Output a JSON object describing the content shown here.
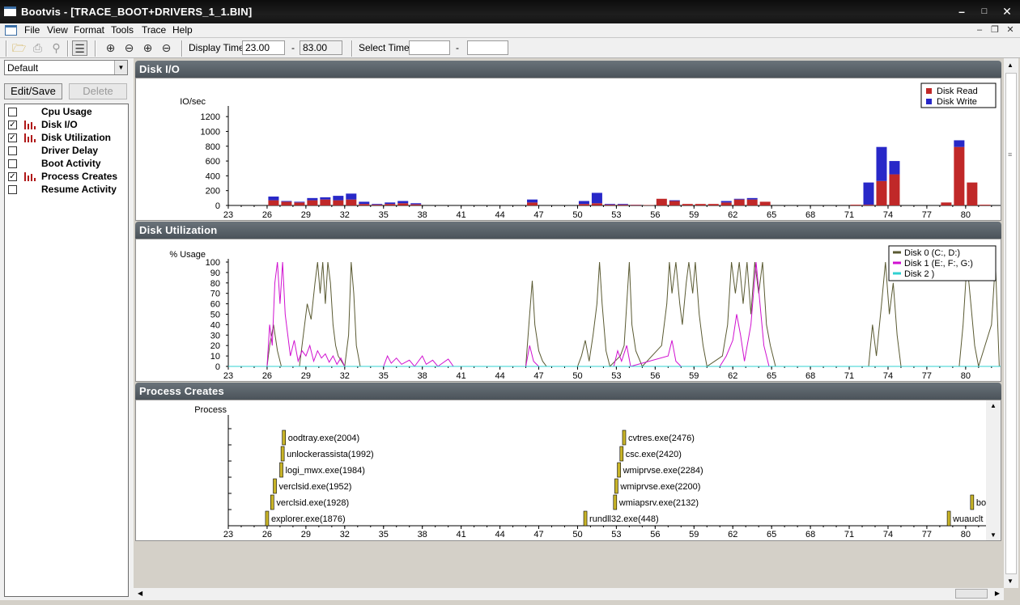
{
  "window": {
    "title": "Bootvis - [TRACE_BOOT+DRIVERS_1_1.BIN]"
  },
  "menu": [
    "File",
    "View",
    "Format",
    "Tools",
    "Trace",
    "Help"
  ],
  "toolbar": {
    "display_time_label": "Display Time",
    "display_start": "23.00",
    "display_dash": "-",
    "display_end": "83.00",
    "select_time_label": "Select Time",
    "select_start": "",
    "select_dash": "-",
    "select_end": ""
  },
  "sidebar": {
    "preset": "Default",
    "edit_save_label": "Edit/Save",
    "delete_label": "Delete",
    "items": [
      {
        "label": "Cpu Usage",
        "checked": false
      },
      {
        "label": "Disk I/O",
        "checked": true
      },
      {
        "label": "Disk Utilization",
        "checked": true
      },
      {
        "label": "Driver Delay",
        "checked": false
      },
      {
        "label": "Boot Activity",
        "checked": false
      },
      {
        "label": "Process Creates",
        "checked": true
      },
      {
        "label": "Resume Activity",
        "checked": false
      }
    ]
  },
  "colors": {
    "read": "#c02828",
    "write": "#2828c8",
    "disk0": "#5a5a32",
    "disk1": "#d010d0",
    "disk2": "#30d0d0",
    "process": "#c8b428"
  },
  "x_ticks": [
    "23",
    "26",
    "29",
    "32",
    "35",
    "38",
    "41",
    "44",
    "47",
    "50",
    "53",
    "56",
    "59",
    "62",
    "65",
    "68",
    "71",
    "74",
    "77",
    "80"
  ],
  "chart_data": [
    {
      "type": "bar",
      "title": "Disk I/O",
      "ylabel": "IO/sec",
      "ylim": [
        0,
        1300
      ],
      "yticks": [
        "0",
        "200",
        "400",
        "600",
        "800",
        "1000",
        "1200"
      ],
      "xlim": [
        23,
        83
      ],
      "legend_position": "top-right",
      "series": [
        {
          "name": "Disk Read",
          "color": "#c02828",
          "points": [
            [
              26.5,
              70
            ],
            [
              27.5,
              50
            ],
            [
              28.5,
              40
            ],
            [
              29.5,
              70
            ],
            [
              30.5,
              80
            ],
            [
              31.5,
              70
            ],
            [
              32.5,
              80
            ],
            [
              33.5,
              20
            ],
            [
              34.5,
              10
            ],
            [
              35.5,
              20
            ],
            [
              36.5,
              30
            ],
            [
              37.5,
              15
            ],
            [
              46.5,
              40
            ],
            [
              50.5,
              20
            ],
            [
              51.5,
              30
            ],
            [
              52.5,
              10
            ],
            [
              53.5,
              10
            ],
            [
              54.5,
              8
            ],
            [
              55.5,
              5
            ],
            [
              56.5,
              90
            ],
            [
              57.5,
              60
            ],
            [
              58.5,
              20
            ],
            [
              59.5,
              20
            ],
            [
              60.5,
              20
            ],
            [
              61.5,
              40
            ],
            [
              62.5,
              80
            ],
            [
              63.5,
              80
            ],
            [
              64.5,
              50
            ],
            [
              71.5,
              10
            ],
            [
              72.5,
              10
            ],
            [
              73.5,
              330
            ],
            [
              74.5,
              420
            ],
            [
              78.5,
              40
            ],
            [
              79.5,
              790
            ],
            [
              80.5,
              310
            ],
            [
              81.5,
              10
            ]
          ]
        },
        {
          "name": "Disk Write",
          "color": "#2828c8",
          "points": [
            [
              26.5,
              50
            ],
            [
              27.5,
              10
            ],
            [
              28.5,
              10
            ],
            [
              29.5,
              30
            ],
            [
              30.5,
              30
            ],
            [
              31.5,
              60
            ],
            [
              32.5,
              80
            ],
            [
              33.5,
              30
            ],
            [
              34.5,
              10
            ],
            [
              35.5,
              20
            ],
            [
              36.5,
              30
            ],
            [
              37.5,
              15
            ],
            [
              46.5,
              40
            ],
            [
              50.5,
              40
            ],
            [
              51.5,
              140
            ],
            [
              52.5,
              10
            ],
            [
              53.5,
              10
            ],
            [
              54.5,
              2
            ],
            [
              55.5,
              0
            ],
            [
              56.5,
              0
            ],
            [
              57.5,
              10
            ],
            [
              58.5,
              0
            ],
            [
              59.5,
              0
            ],
            [
              60.5,
              0
            ],
            [
              61.5,
              20
            ],
            [
              62.5,
              10
            ],
            [
              63.5,
              20
            ],
            [
              64.5,
              0
            ],
            [
              71.5,
              0
            ],
            [
              72.5,
              300
            ],
            [
              73.5,
              460
            ],
            [
              74.5,
              180
            ],
            [
              78.5,
              0
            ],
            [
              79.5,
              90
            ],
            [
              80.5,
              0
            ],
            [
              81.5,
              0
            ]
          ]
        }
      ]
    },
    {
      "type": "line",
      "title": "Disk Utilization",
      "ylabel": "% Usage",
      "ylim": [
        0,
        100
      ],
      "yticks": [
        "0",
        "10",
        "20",
        "30",
        "40",
        "50",
        "60",
        "70",
        "80",
        "90",
        "100"
      ],
      "xlim": [
        23,
        83
      ],
      "legend_position": "top-right",
      "series": [
        {
          "name": "Disk 0 (C:, D:)",
          "color": "#5a5a32",
          "points": [
            [
              23,
              0
            ],
            [
              26,
              0
            ],
            [
              26.2,
              20
            ],
            [
              26.5,
              40
            ],
            [
              26.8,
              15
            ],
            [
              27.1,
              0
            ],
            [
              28.5,
              0
            ],
            [
              28.8,
              30
            ],
            [
              29.1,
              60
            ],
            [
              29.4,
              45
            ],
            [
              29.7,
              80
            ],
            [
              29.9,
              100
            ],
            [
              30.1,
              70
            ],
            [
              30.3,
              100
            ],
            [
              30.5,
              60
            ],
            [
              30.7,
              100
            ],
            [
              30.9,
              80
            ],
            [
              31.1,
              40
            ],
            [
              31.3,
              20
            ],
            [
              31.5,
              10
            ],
            [
              32,
              0
            ],
            [
              32.3,
              30
            ],
            [
              32.5,
              100
            ],
            [
              32.7,
              70
            ],
            [
              32.9,
              20
            ],
            [
              33.2,
              0
            ],
            [
              46,
              0
            ],
            [
              46.3,
              50
            ],
            [
              46.5,
              82
            ],
            [
              46.7,
              40
            ],
            [
              47,
              15
            ],
            [
              47.3,
              5
            ],
            [
              47.6,
              0
            ],
            [
              50,
              0
            ],
            [
              50.3,
              10
            ],
            [
              50.6,
              25
            ],
            [
              50.9,
              5
            ],
            [
              51.2,
              30
            ],
            [
              51.5,
              60
            ],
            [
              51.7,
              100
            ],
            [
              51.9,
              60
            ],
            [
              52.2,
              15
            ],
            [
              52.5,
              0
            ],
            [
              53.3,
              10
            ],
            [
              53.6,
              20
            ],
            [
              54,
              100
            ],
            [
              54.2,
              40
            ],
            [
              54.5,
              15
            ],
            [
              55,
              0
            ],
            [
              56.5,
              20
            ],
            [
              56.9,
              60
            ],
            [
              57.1,
              100
            ],
            [
              57.3,
              70
            ],
            [
              57.6,
              100
            ],
            [
              57.9,
              60
            ],
            [
              58.1,
              40
            ],
            [
              58.4,
              80
            ],
            [
              58.6,
              100
            ],
            [
              58.9,
              70
            ],
            [
              59.1,
              100
            ],
            [
              59.4,
              50
            ],
            [
              59.7,
              20
            ],
            [
              60,
              0
            ],
            [
              61.2,
              10
            ],
            [
              61.6,
              40
            ],
            [
              61.9,
              100
            ],
            [
              62.2,
              70
            ],
            [
              62.5,
              100
            ],
            [
              62.8,
              60
            ],
            [
              63.1,
              100
            ],
            [
              63.4,
              50
            ],
            [
              63.7,
              100
            ],
            [
              64,
              70
            ],
            [
              64.3,
              100
            ],
            [
              64.6,
              40
            ],
            [
              64.9,
              20
            ],
            [
              65.3,
              0
            ],
            [
              72.5,
              0
            ],
            [
              72.8,
              40
            ],
            [
              73.1,
              10
            ],
            [
              73.5,
              60
            ],
            [
              73.8,
              100
            ],
            [
              74.1,
              50
            ],
            [
              74.4,
              80
            ],
            [
              74.7,
              30
            ],
            [
              75,
              0
            ],
            [
              79.5,
              0
            ],
            [
              79.8,
              40
            ],
            [
              80.1,
              100
            ],
            [
              80.4,
              60
            ],
            [
              80.7,
              20
            ],
            [
              81,
              0
            ],
            [
              82,
              40
            ],
            [
              82.3,
              100
            ],
            [
              82.6,
              0
            ],
            [
              83,
              0
            ]
          ]
        },
        {
          "name": "Disk 1 (E:, F:, G:)",
          "color": "#d010d0",
          "points": [
            [
              23,
              0
            ],
            [
              26,
              0
            ],
            [
              26.2,
              40
            ],
            [
              26.4,
              20
            ],
            [
              26.6,
              80
            ],
            [
              26.8,
              100
            ],
            [
              27,
              60
            ],
            [
              27.2,
              100
            ],
            [
              27.4,
              50
            ],
            [
              27.6,
              30
            ],
            [
              27.8,
              10
            ],
            [
              28.1,
              25
            ],
            [
              28.4,
              5
            ],
            [
              28.7,
              15
            ],
            [
              29,
              10
            ],
            [
              29.3,
              20
            ],
            [
              29.6,
              5
            ],
            [
              29.9,
              15
            ],
            [
              30.2,
              8
            ],
            [
              30.5,
              12
            ],
            [
              30.8,
              4
            ],
            [
              31.1,
              10
            ],
            [
              31.4,
              2
            ],
            [
              31.7,
              8
            ],
            [
              32,
              0
            ],
            [
              35,
              0
            ],
            [
              35.3,
              10
            ],
            [
              35.6,
              3
            ],
            [
              36,
              8
            ],
            [
              36.4,
              2
            ],
            [
              37,
              6
            ],
            [
              37.4,
              0
            ],
            [
              38,
              10
            ],
            [
              38.3,
              2
            ],
            [
              38.8,
              6
            ],
            [
              39.2,
              0
            ],
            [
              40,
              7
            ],
            [
              40.4,
              0
            ],
            [
              46,
              0
            ],
            [
              46.3,
              20
            ],
            [
              46.6,
              5
            ],
            [
              47,
              0
            ],
            [
              52.8,
              0
            ],
            [
              53.1,
              15
            ],
            [
              53.4,
              5
            ],
            [
              53.8,
              20
            ],
            [
              54.1,
              0
            ],
            [
              57,
              10
            ],
            [
              57.3,
              25
            ],
            [
              57.6,
              5
            ],
            [
              58,
              0
            ],
            [
              61,
              0
            ],
            [
              61.5,
              10
            ],
            [
              62,
              25
            ],
            [
              62.3,
              50
            ],
            [
              62.6,
              30
            ],
            [
              62.9,
              5
            ],
            [
              63.4,
              40
            ],
            [
              63.8,
              100
            ],
            [
              64.1,
              60
            ],
            [
              64.4,
              20
            ],
            [
              64.8,
              0
            ],
            [
              83,
              0
            ]
          ]
        },
        {
          "name": "Disk 2 )",
          "color": "#30d0d0",
          "points": [
            [
              23,
              0
            ],
            [
              83,
              0
            ]
          ]
        }
      ]
    },
    {
      "type": "scatter",
      "title": "Process Creates",
      "ylabel": "Process",
      "xlim": [
        23,
        83
      ],
      "points": [
        {
          "x": 26.0,
          "row": 0,
          "label": "explorer.exe(1876)"
        },
        {
          "x": 26.4,
          "row": 1,
          "label": "verclsid.exe(1928)"
        },
        {
          "x": 26.6,
          "row": 2,
          "label": "verclsid.exe(1952)"
        },
        {
          "x": 27.1,
          "row": 3,
          "label": "logi_mwx.exe(1984)"
        },
        {
          "x": 27.2,
          "row": 4,
          "label": "unlockerassista(1992)"
        },
        {
          "x": 27.3,
          "row": 5,
          "label": "oodtray.exe(2004)"
        },
        {
          "x": 50.6,
          "row": 0,
          "label": "rundll32.exe(448)"
        },
        {
          "x": 52.9,
          "row": 1,
          "label": "wmiapsrv.exe(2132)"
        },
        {
          "x": 53.0,
          "row": 2,
          "label": "wmiprvse.exe(2200)"
        },
        {
          "x": 53.2,
          "row": 3,
          "label": "wmiprvse.exe(2284)"
        },
        {
          "x": 53.4,
          "row": 4,
          "label": "csc.exe(2420)"
        },
        {
          "x": 53.6,
          "row": 5,
          "label": "cvtres.exe(2476)"
        },
        {
          "x": 78.7,
          "row": 0,
          "label": "wuauclt"
        },
        {
          "x": 80.5,
          "row": 1,
          "label": "bo"
        }
      ]
    }
  ]
}
